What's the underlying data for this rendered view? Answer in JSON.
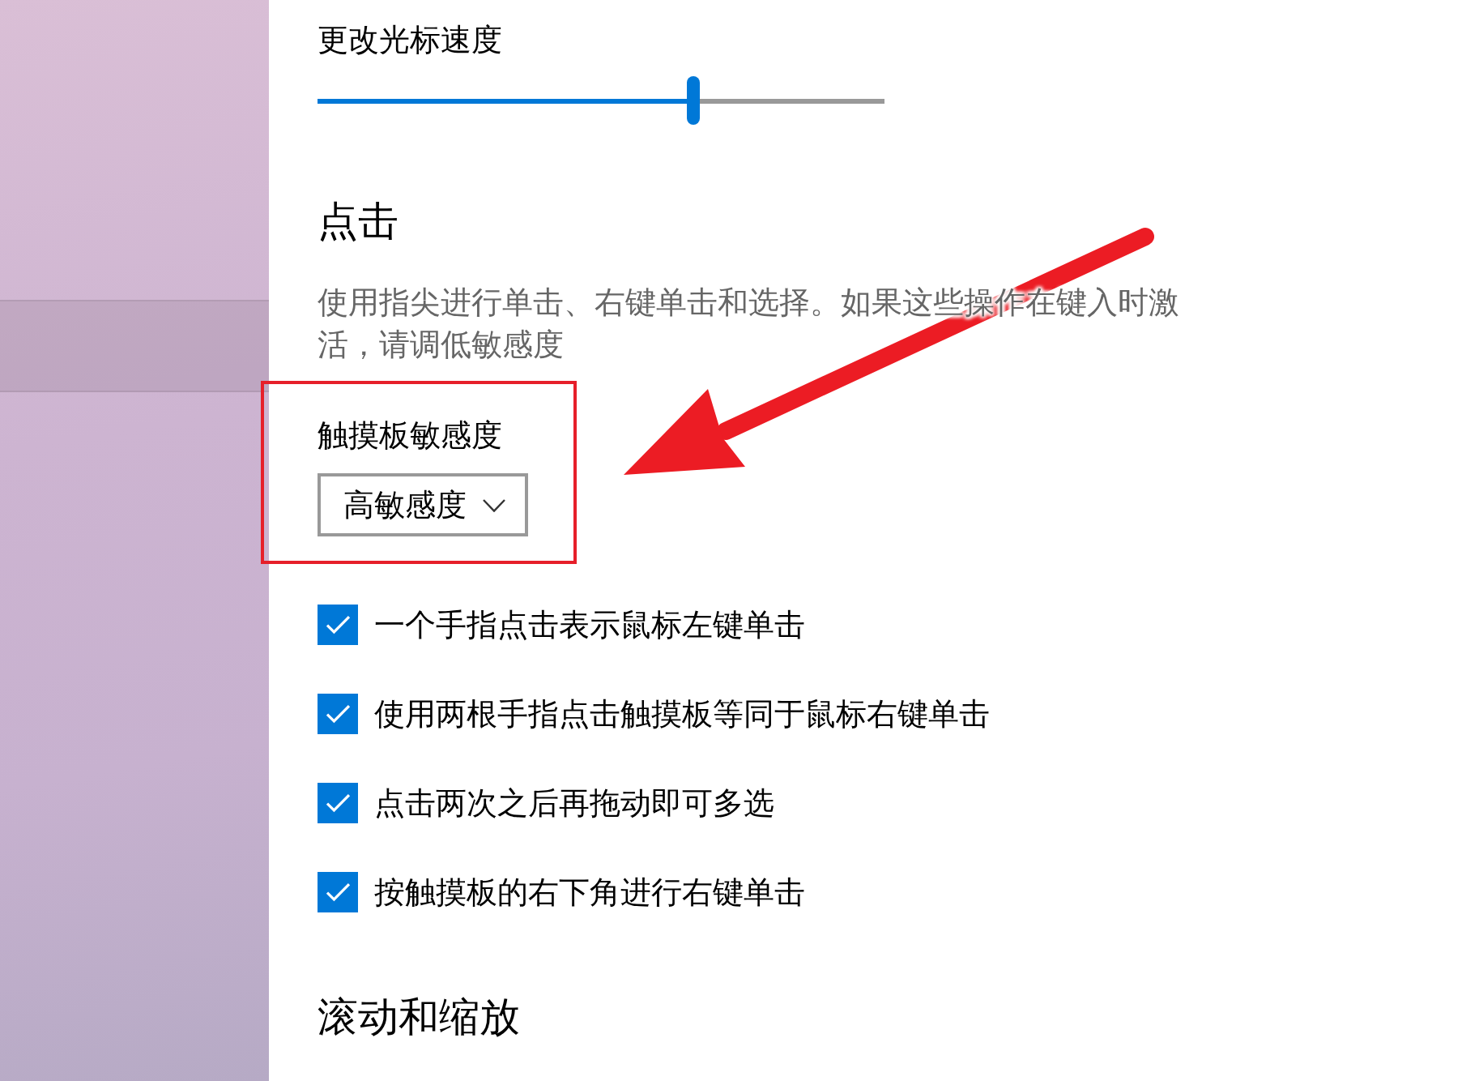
{
  "pointer_speed": {
    "label": "更改光标速度",
    "level": 0.663
  },
  "taps": {
    "heading": "点击",
    "description": "使用指尖进行单击、右键单击和选择。如果这些操作在键入时激活，请调低敏感度",
    "sensitivity": {
      "label": "触摸板敏感度",
      "value": "高敏感度"
    },
    "options": [
      {
        "label": "一个手指点击表示鼠标左键单击",
        "checked": true
      },
      {
        "label": "使用两根手指点击触摸板等同于鼠标右键单击",
        "checked": true
      },
      {
        "label": "点击两次之后再拖动即可多选",
        "checked": true
      },
      {
        "label": "按触摸板的右下角进行右键单击",
        "checked": true
      }
    ]
  },
  "scroll_zoom": {
    "heading": "滚动和缩放"
  }
}
